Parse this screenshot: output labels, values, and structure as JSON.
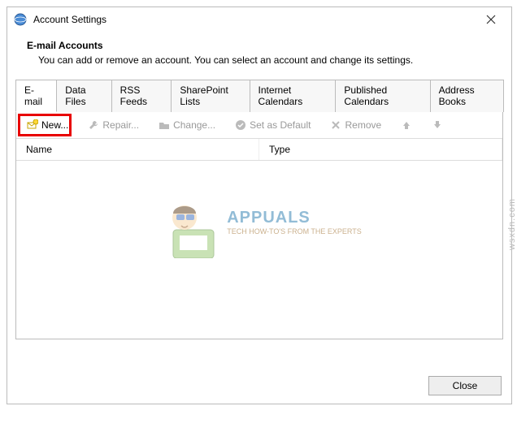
{
  "window": {
    "title": "Account Settings"
  },
  "header": {
    "title": "E-mail Accounts",
    "subtitle": "You can add or remove an account. You can select an account and change its settings."
  },
  "tabs": [
    {
      "label": "E-mail"
    },
    {
      "label": "Data Files"
    },
    {
      "label": "RSS Feeds"
    },
    {
      "label": "SharePoint Lists"
    },
    {
      "label": "Internet Calendars"
    },
    {
      "label": "Published Calendars"
    },
    {
      "label": "Address Books"
    }
  ],
  "toolbar": {
    "new": "New...",
    "repair": "Repair...",
    "change": "Change...",
    "setdefault": "Set as Default",
    "remove": "Remove"
  },
  "columns": {
    "name": "Name",
    "type": "Type"
  },
  "buttons": {
    "close": "Close"
  },
  "watermark": {
    "brand": "APPUALS",
    "tagline": "TECH HOW-TO'S FROM THE EXPERTS"
  },
  "source": "wsxdn.com"
}
